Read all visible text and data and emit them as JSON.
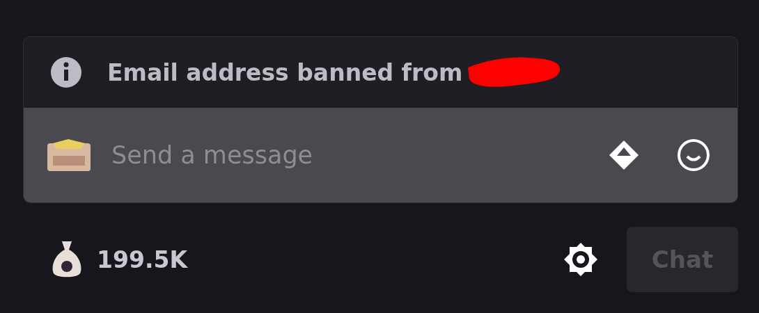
{
  "notice": {
    "message": "Email address banned from"
  },
  "chat_input": {
    "placeholder": "Send a message"
  },
  "footer": {
    "points": "199.5K",
    "chat_button": {
      "label": "Chat",
      "disabled": true
    }
  }
}
